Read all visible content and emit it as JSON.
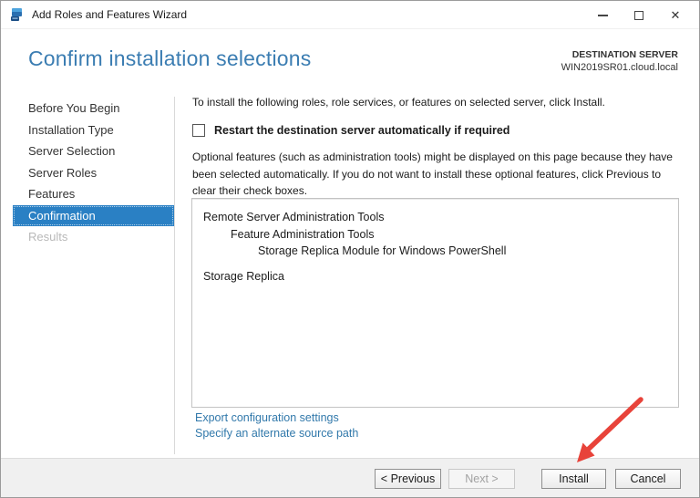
{
  "window": {
    "title": "Add Roles and Features Wizard",
    "icons": {
      "close": "✕"
    }
  },
  "header": {
    "title": "Confirm installation selections",
    "destination_label": "DESTINATION SERVER",
    "destination_server": "WIN2019SR01.cloud.local"
  },
  "sidebar": {
    "items": [
      {
        "label": "Before You Begin",
        "state": "normal"
      },
      {
        "label": "Installation Type",
        "state": "normal"
      },
      {
        "label": "Server Selection",
        "state": "normal"
      },
      {
        "label": "Server Roles",
        "state": "normal"
      },
      {
        "label": "Features",
        "state": "normal"
      },
      {
        "label": "Confirmation",
        "state": "selected"
      },
      {
        "label": "Results",
        "state": "disabled"
      }
    ]
  },
  "main": {
    "intro": "To install the following roles, role services, or features on selected server, click Install.",
    "restart_checkbox": {
      "label": "Restart the destination server automatically if required",
      "checked": false
    },
    "optional_note": "Optional features (such as administration tools) might be displayed on this page because they have been selected automatically. If you do not want to install these optional features, click Previous to clear their check boxes.",
    "selection_list": [
      {
        "text": "Remote Server Administration Tools",
        "indent": 0
      },
      {
        "text": "Feature Administration Tools",
        "indent": 1
      },
      {
        "text": "Storage Replica Module for Windows PowerShell",
        "indent": 2
      },
      {
        "text": "Storage Replica",
        "indent": 0
      }
    ],
    "links": [
      "Export configuration settings",
      "Specify an alternate source path"
    ]
  },
  "footer": {
    "buttons": [
      {
        "label": "< Previous",
        "enabled": true
      },
      {
        "label": "Next >",
        "enabled": false
      },
      {
        "label": "Install",
        "enabled": true
      },
      {
        "label": "Cancel",
        "enabled": true
      }
    ]
  },
  "annotation": {
    "arrow_color": "#e8433a",
    "points_to": "Install"
  },
  "colors": {
    "accent_blue": "#2a80c4",
    "title_blue": "#3b7db2",
    "link_blue": "#3279ab",
    "footer_gray": "#f0f0f0"
  }
}
